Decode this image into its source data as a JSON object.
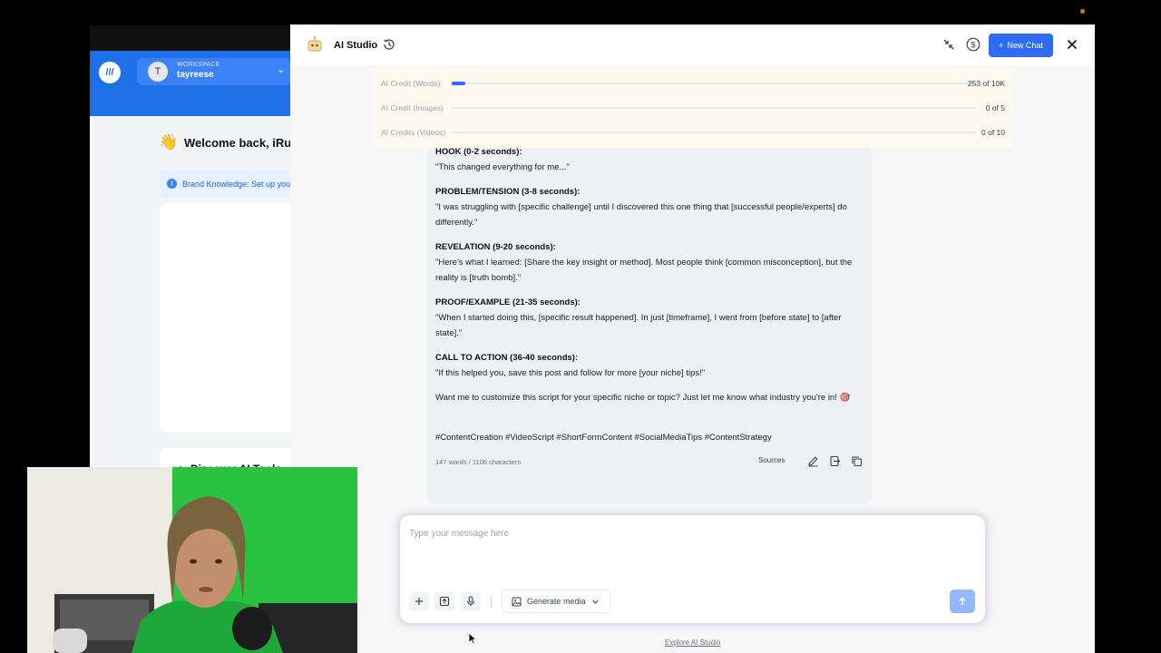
{
  "workspace": {
    "label": "WORKSPACE",
    "avatar_initial": "T",
    "name": "tayreese"
  },
  "background": {
    "welcome_emoji": "👋",
    "welcome_text": "Welcome back, iRun",
    "brand_knowledge": "Brand Knowledge: Set up you",
    "discover_title": "Discover AI Tools"
  },
  "header": {
    "title": "AI Studio",
    "new_chat_label": "New Chat",
    "accent": "#2f6bf5"
  },
  "credits": [
    {
      "label": "AI Credit (Words)",
      "value": "253 of 10K",
      "fraction": 0.0253
    },
    {
      "label": "AI Credit (Images)",
      "value": "0 of 5",
      "fraction": 0
    },
    {
      "label": "AI Credits (Videos)",
      "value": "0 of 10",
      "fraction": 0
    }
  ],
  "message": {
    "sections": [
      {
        "heading": "HOOK (0-2 seconds):",
        "text": "\"This changed everything for me...\""
      },
      {
        "heading": "PROBLEM/TENSION (3-8 seconds):",
        "text": "\"I was struggling with [specific challenge] until I discovered this one thing that [successful people/experts] do differently.\""
      },
      {
        "heading": "REVELATION (9-20 seconds):",
        "text": "\"Here's what I learned: [Share the key insight or method]. Most people think [common misconception], but the reality is [truth bomb].\""
      },
      {
        "heading": "PROOF/EXAMPLE (21-35 seconds):",
        "text": "\"When I started doing this, [specific result happened]. In just [timeframe], I went from [before state] to [after state].\""
      },
      {
        "heading": "CALL TO ACTION (36-40 seconds):",
        "text": "\"If this helped you, save this post and follow for more [your niche] tips!\""
      }
    ],
    "closing": "Want me to customize this script for your specific niche or topic? Just let me know what industry you're in! 🎯",
    "hashtags": "#ContentCreation #VideoScript #ShortFormContent #SocialMediaTips #ContentStrategy",
    "meta": "147 words / 1106 characters",
    "sources_label": "Sources"
  },
  "composer": {
    "placeholder": "Type your message here",
    "generate_media_label": "Generate media"
  },
  "footer": {
    "explore_label": "Explore AI Studio"
  }
}
